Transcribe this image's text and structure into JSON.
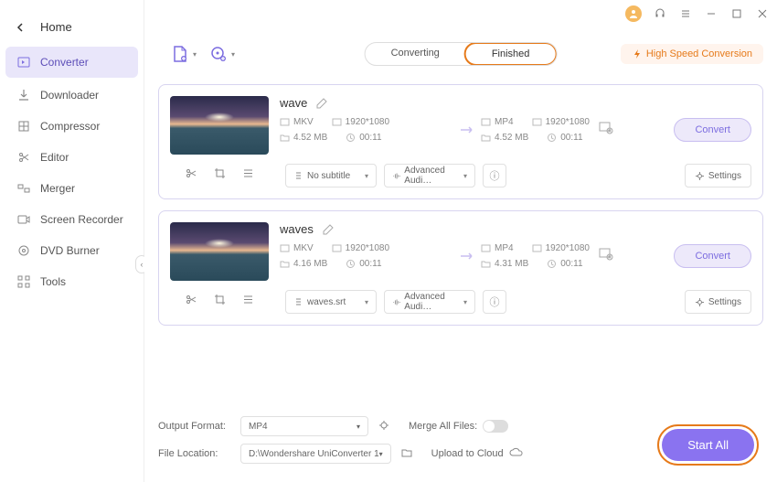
{
  "sidebar": {
    "back": "Home",
    "items": [
      {
        "label": "Converter"
      },
      {
        "label": "Downloader"
      },
      {
        "label": "Compressor"
      },
      {
        "label": "Editor"
      },
      {
        "label": "Merger"
      },
      {
        "label": "Screen Recorder"
      },
      {
        "label": "DVD Burner"
      },
      {
        "label": "Tools"
      }
    ]
  },
  "tabs": {
    "converting": "Converting",
    "finished": "Finished"
  },
  "speed_badge": "High Speed Conversion",
  "files": [
    {
      "name": "wave",
      "src": {
        "fmt": "MKV",
        "res": "1920*1080",
        "size": "4.52 MB",
        "dur": "00:11"
      },
      "dst": {
        "fmt": "MP4",
        "res": "1920*1080",
        "size": "4.52 MB",
        "dur": "00:11"
      },
      "subtitle": "No subtitle",
      "audio": "Advanced Audi…",
      "settings": "Settings",
      "convert": "Convert"
    },
    {
      "name": "waves",
      "src": {
        "fmt": "MKV",
        "res": "1920*1080",
        "size": "4.16 MB",
        "dur": "00:11"
      },
      "dst": {
        "fmt": "MP4",
        "res": "1920*1080",
        "size": "4.31 MB",
        "dur": "00:11"
      },
      "subtitle": "waves.srt",
      "audio": "Advanced Audi…",
      "settings": "Settings",
      "convert": "Convert"
    }
  ],
  "footer": {
    "output_label": "Output Format:",
    "output_value": "MP4",
    "location_label": "File Location:",
    "location_value": "D:\\Wondershare UniConverter 1",
    "merge_label": "Merge All Files:",
    "upload_label": "Upload to Cloud"
  },
  "start_all": "Start All"
}
